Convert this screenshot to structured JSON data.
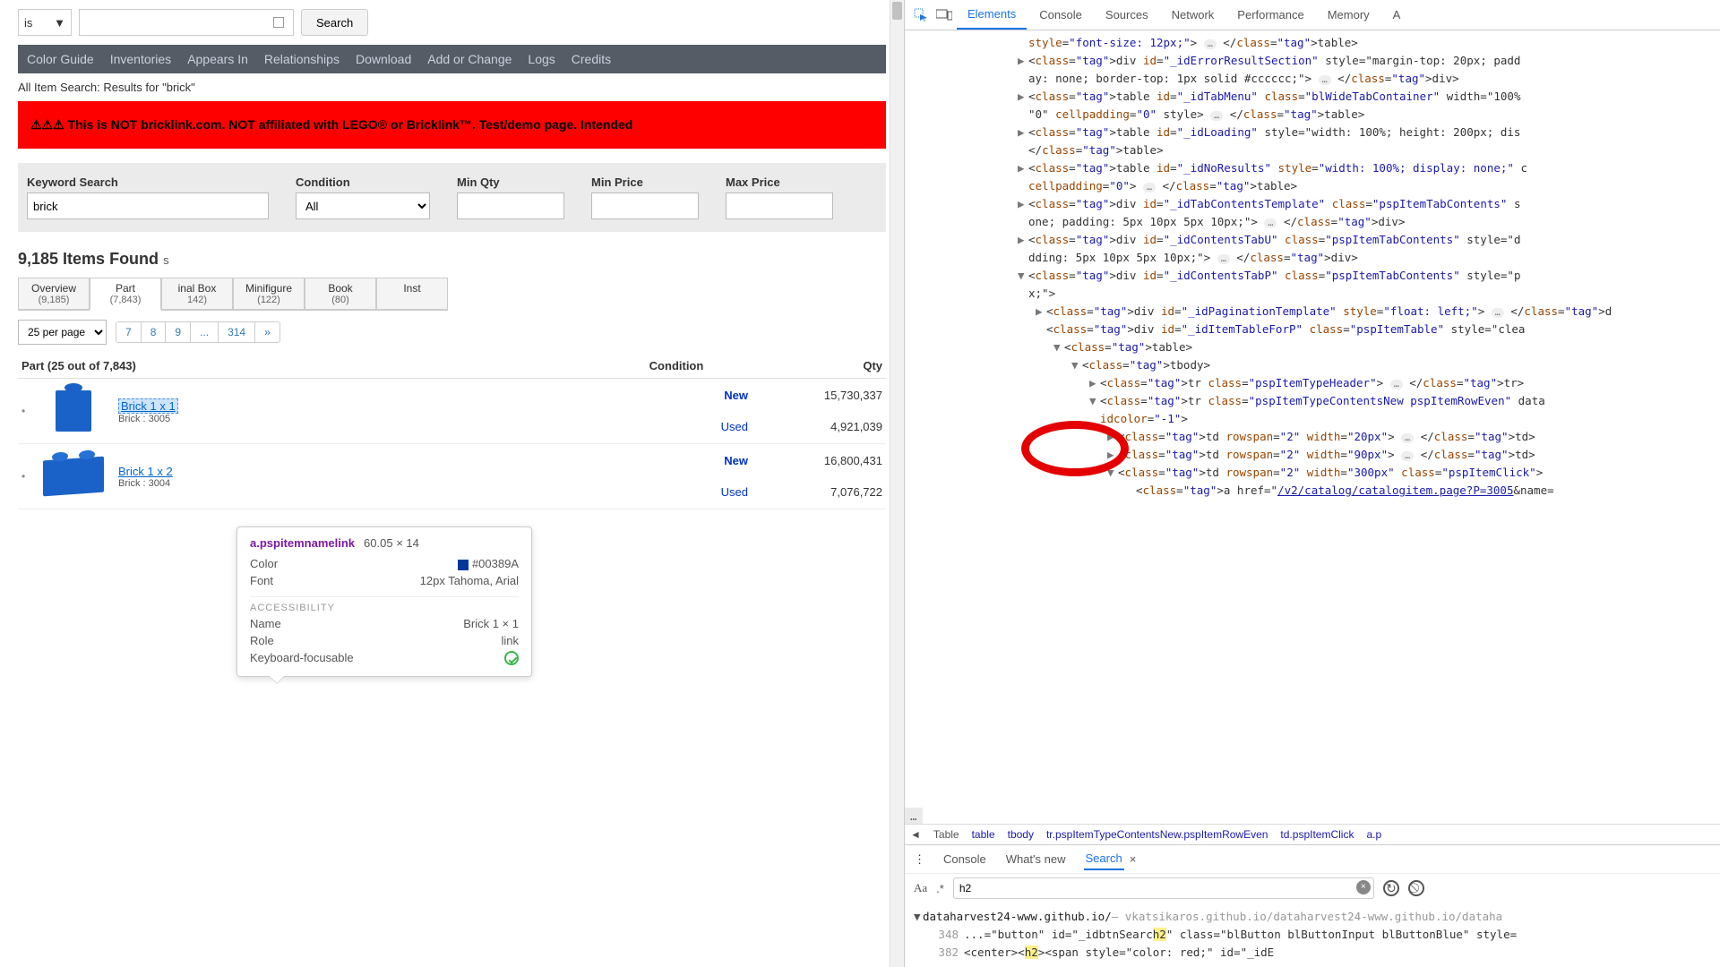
{
  "left": {
    "topsearch": {
      "dropdown_suffix": "is",
      "search_button": "Search"
    },
    "navbar": [
      "Color Guide",
      "Inventories",
      "Appears In",
      "Relationships",
      "Download",
      "Add or Change",
      "Logs",
      "Credits"
    ],
    "subhead": "All Item Search: Results for \"brick\"",
    "warn": "⚠⚠⚠ This is NOT bricklink.com. NOT affiliated with LEGO® or Bricklink™. Test/demo page. Intended",
    "filters": {
      "keyword_label": "Keyword Search",
      "keyword_value": "brick",
      "condition_label": "Condition",
      "condition_value": "All",
      "minqty_label": "Min Qty",
      "minprice_label": "Min Price",
      "maxprice_label": "Max Price"
    },
    "found_prefix": "9,185 Items Found",
    "found_suffix": "s",
    "tabs": [
      {
        "label": "Overview",
        "count": "(9,185)"
      },
      {
        "label": "Part",
        "count": "(7,843)"
      },
      {
        "label": "inal Box",
        "count": "142)"
      },
      {
        "label": "Minifigure",
        "count": "(122)"
      },
      {
        "label": "Book",
        "count": "(80)"
      },
      {
        "label": "Inst",
        "count": ""
      }
    ],
    "perpage": "25 per page",
    "pager": [
      "7",
      "8",
      "9",
      "...",
      "314",
      "»"
    ],
    "results_header": {
      "section": "Part (25 out of 7,843)",
      "cond": "Condition",
      "qty": "Qty"
    },
    "rows": [
      {
        "name": "Brick 1 x 1",
        "sub": "Brick : 3005",
        "new": "New",
        "used": "Used",
        "q1": "15,730,337",
        "q2": "4,921,039"
      },
      {
        "name": "Brick 1 x 2",
        "sub": "Brick : 3004",
        "new": "New",
        "used": "Used",
        "q1": "16,800,431",
        "q2": "7,076,722"
      }
    ],
    "tooltip": {
      "selector": "a.pspitemnamelink",
      "dims": "60.05 × 14",
      "rows": [
        {
          "k": "Color",
          "v": "#00389A"
        },
        {
          "k": "Font",
          "v": "12px Tahoma, Arial"
        }
      ],
      "acc_label": "ACCESSIBILITY",
      "acc": [
        {
          "k": "Name",
          "v": "Brick 1 × 1"
        },
        {
          "k": "Role",
          "v": "link"
        },
        {
          "k": "Keyboard-focusable",
          "v": "ok"
        }
      ]
    }
  },
  "devtools": {
    "tabs": [
      "Elements",
      "Console",
      "Sources",
      "Network",
      "Performance",
      "Memory",
      "A"
    ],
    "dom": [
      {
        "ind": 1,
        "raw": "style=\"font-size: 12px;\"> … </table>"
      },
      {
        "ind": 1,
        "arrow": "▶",
        "raw": "<div id=\"_idErrorResultSection\" style=\"margin-top: 20px; padd"
      },
      {
        "ind": 1,
        "raw": "ay: none; border-top: 1px solid #cccccc;\"> … </div>"
      },
      {
        "ind": 1,
        "arrow": "▶",
        "raw": "<table id=\"_idTabMenu\" class=\"blWideTabContainer\" width=\"100%"
      },
      {
        "ind": 1,
        "raw": "\"0\" cellpadding=\"0\" style> … </table>"
      },
      {
        "ind": 1,
        "arrow": "▶",
        "raw": "<table id=\"_idLoading\" style=\"width: 100%; height: 200px; dis"
      },
      {
        "ind": 1,
        "raw": "</table>"
      },
      {
        "ind": 1,
        "arrow": "▶",
        "raw": "<table id=\"_idNoResults\" style=\"width: 100%; display: none;\" c"
      },
      {
        "ind": 1,
        "raw": "cellpadding=\"0\"> … </table>"
      },
      {
        "ind": 1,
        "arrow": "▶",
        "raw": "<div id=\"_idTabContentsTemplate\" class=\"pspItemTabContents\" s"
      },
      {
        "ind": 1,
        "raw": "one; padding: 5px 10px 5px 10px;\"> … </div>"
      },
      {
        "ind": 1,
        "arrow": "▶",
        "raw": "<div id=\"_idContentsTabU\" class=\"pspItemTabContents\" style=\"d"
      },
      {
        "ind": 1,
        "raw": "dding: 5px 10px 5px 10px;\"> … </div>"
      },
      {
        "ind": 1,
        "arrow": "▼",
        "raw": "<div id=\"_idContentsTabP\" class=\"pspItemTabContents\" style=\"p"
      },
      {
        "ind": 1,
        "raw": "x;\">"
      },
      {
        "ind": 2,
        "arrow": "▶",
        "raw": "<div id=\"_idPaginationTemplate\" style=\"float: left;\"> … </d"
      },
      {
        "ind": 2,
        "raw": "<div id=\"_idItemTableForP\" class=\"pspItemTable\" style=\"clea"
      },
      {
        "ind": 3,
        "arrow": "▼",
        "raw": "<table>"
      },
      {
        "ind": 4,
        "arrow": "▼",
        "raw": "<tbody>"
      },
      {
        "ind": 5,
        "arrow": "▶",
        "raw": "<tr class=\"pspItemTypeHeader\"> … </tr>"
      },
      {
        "ind": 5,
        "arrow": "▼",
        "raw": "<tr class=\"pspItemTypeContentsNew pspItemRowEven\" data"
      },
      {
        "ind": 5,
        "raw": "idcolor=\"-1\">"
      },
      {
        "ind": 6,
        "arrow": "▶",
        "raw": "<td rowspan=\"2\" width=\"20px\"> … </td>"
      },
      {
        "ind": 6,
        "arrow": "▶",
        "raw": "<td rowspan=\"2\" width=\"90px\"> … </td>"
      },
      {
        "ind": 6,
        "arrow": "▼",
        "raw": "<td rowspan=\"2\" width=\"300px\" class=\"pspItemClick\">"
      },
      {
        "ind": 7,
        "raw": "<a href=\"/v2/catalog/catalogitem.page?P=3005&name="
      }
    ],
    "breadcrumb": [
      "◄",
      "Table",
      "table",
      "tbody",
      "tr.pspItemTypeContentsNew.pspItemRowEven",
      "td.pspItemClick",
      "a.p"
    ],
    "drawer_tabs": [
      "Console",
      "What's new",
      "Search"
    ],
    "search": {
      "value": "h2",
      "results": {
        "host": "dataharvest24-www.github.io/",
        "host_gray": "— vkatsikaros.github.io/dataharvest24-www.github.io/dataha",
        "lines": [
          {
            "n": "348",
            "t_before": "...=\"button\" id=\"_idbtnSearc",
            "hl": "h2",
            "t_after": "\" class=\"blButton blButtonInput blButtonBlue\" style="
          },
          {
            "n": "382",
            "t_before": "<center><",
            "hl": "h2",
            "t_after": "><span style=\"color: red;\" id=\"_idE"
          }
        ]
      }
    }
  }
}
